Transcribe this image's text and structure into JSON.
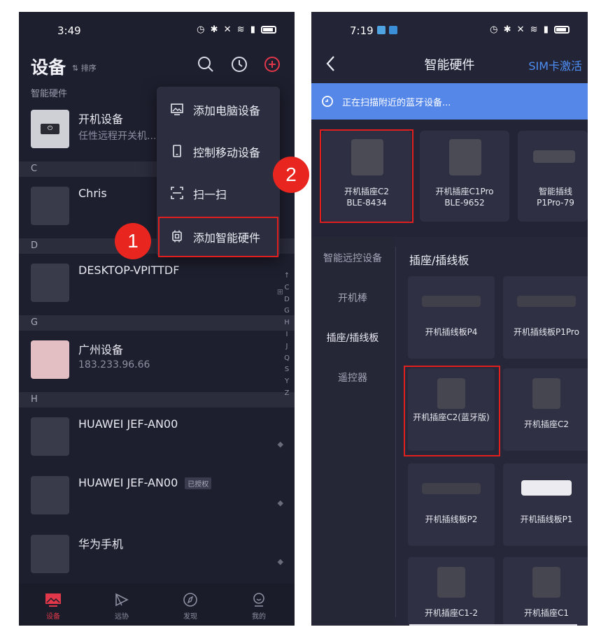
{
  "left_phone": {
    "status_time": "3:49",
    "header": {
      "title": "设备",
      "sort_label": "⇅ 排序"
    },
    "smart_section_label": "智能硬件",
    "section_headers": [
      "C",
      "D",
      "G",
      "H"
    ],
    "devices": [
      {
        "name": "开机设备",
        "subtitle": "任性远程开关机...",
        "badge": ""
      },
      {
        "name": "Chris",
        "subtitle": "",
        "badge": ""
      },
      {
        "name": "DESKTOP-VPITTDF",
        "subtitle": "",
        "badge": ""
      },
      {
        "name": "广州设备",
        "subtitle": "183.233.96.66",
        "badge": ""
      },
      {
        "name": "HUAWEI JEF-AN00",
        "subtitle": "",
        "badge": ""
      },
      {
        "name": "HUAWEI JEF-AN00",
        "subtitle": "",
        "badge": "已授权"
      },
      {
        "name": "华为手机",
        "subtitle": "",
        "badge": ""
      }
    ],
    "alpha_index": [
      "↑",
      "C",
      "D",
      "G",
      "H",
      "I",
      "J",
      "Q",
      "S",
      "Y",
      "Z"
    ],
    "dropdown": [
      {
        "label": "添加电脑设备",
        "icon": "monitor-image-icon"
      },
      {
        "label": "控制移动设备",
        "icon": "phone-icon"
      },
      {
        "label": "扫一扫",
        "icon": "scan-icon"
      },
      {
        "label": "添加智能硬件",
        "icon": "chip-icon"
      }
    ],
    "tabs": [
      {
        "label": "设备",
        "active": true
      },
      {
        "label": "远协",
        "active": false
      },
      {
        "label": "发现",
        "active": false
      },
      {
        "label": "我的",
        "active": false
      }
    ]
  },
  "right_phone": {
    "status_time": "7:19",
    "header": {
      "title": "智能硬件",
      "action": "SIM卡激活"
    },
    "scan_banner": "正在扫描附近的蓝牙设备...",
    "nearby_devices": [
      {
        "name": "开机插座C2",
        "id": "BLE-8434"
      },
      {
        "name": "开机插座C1Pro",
        "id": "BLE-9652"
      },
      {
        "name": "智能插线",
        "id": "P1Pro-79"
      }
    ],
    "categories": [
      {
        "label": "智能远控设备",
        "active": false
      },
      {
        "label": "开机棒",
        "active": false
      },
      {
        "label": "插座/插线板",
        "active": true
      },
      {
        "label": "遥控器",
        "active": false
      }
    ],
    "category_heading": "插座/插线板",
    "products": [
      {
        "name": "开机插线板P4"
      },
      {
        "name": "开机插线板P1Pro"
      },
      {
        "name": "开机插座C2(蓝牙版)"
      },
      {
        "name": "开机插座C2"
      },
      {
        "name": "开机插线板P2"
      },
      {
        "name": "开机插线板P1"
      },
      {
        "name": "开机插座C1-2"
      },
      {
        "name": "开机插座C1"
      }
    ]
  },
  "annotations": {
    "step1": "1",
    "step2": "2"
  },
  "colors": {
    "accent_blue": "#4e8ff6",
    "scan_banner": "#5587e9",
    "highlight_red": "#e0201e",
    "tab_active": "#e0384a"
  }
}
